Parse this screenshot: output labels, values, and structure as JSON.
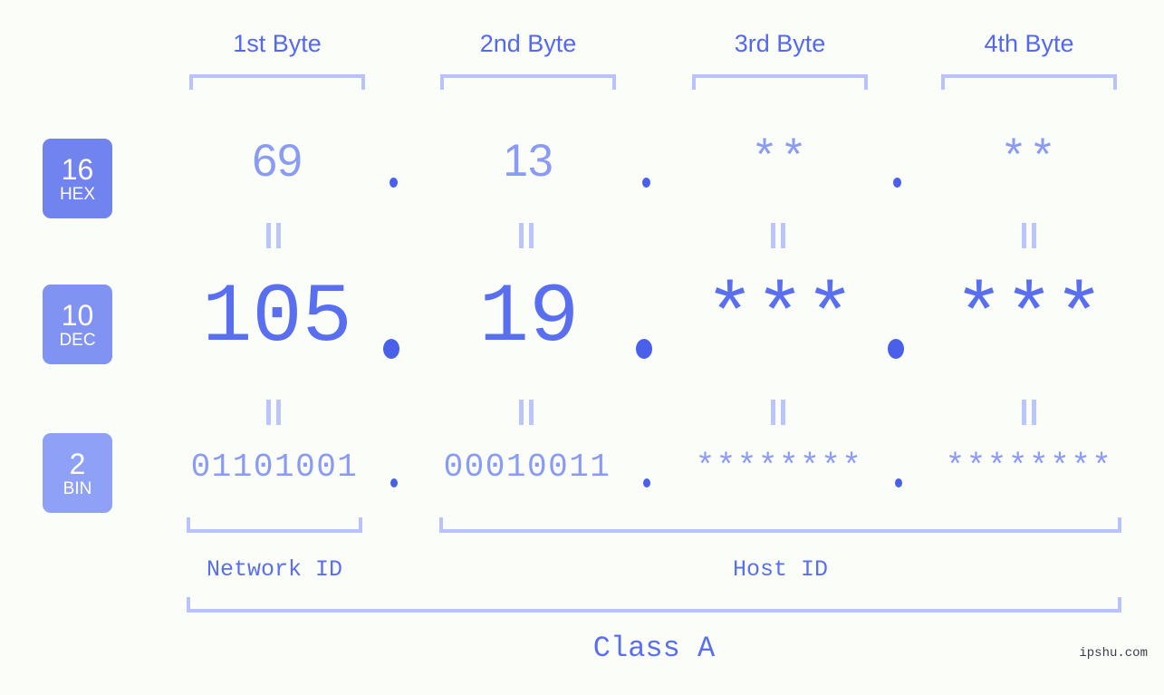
{
  "background_color": "#fbfdf9",
  "accent_color": "#5a6ef0",
  "muted_accent_color": "#8a9bf5",
  "bracket_color": "#b9c2fb",
  "byte_headers": [
    {
      "label": "1st Byte"
    },
    {
      "label": "2nd Byte"
    },
    {
      "label": "3rd Byte"
    },
    {
      "label": "4th Byte"
    }
  ],
  "bases": [
    {
      "number": "16",
      "name": "HEX",
      "color": "#7183ef"
    },
    {
      "number": "10",
      "name": "DEC",
      "color": "#8093f3"
    },
    {
      "number": "2",
      "name": "BIN",
      "color": "#8fa1f6"
    }
  ],
  "rows": {
    "hex": {
      "values": [
        "69",
        "13",
        "**",
        "**"
      ],
      "separator": "."
    },
    "dec": {
      "values": [
        "105",
        "19",
        "***",
        "***"
      ],
      "separator": "."
    },
    "bin": {
      "values": [
        "01101001",
        "00010011",
        "********",
        "********"
      ],
      "separator": "."
    }
  },
  "equality_symbol": "||",
  "sections": {
    "network_id": "Network ID",
    "host_id": "Host ID",
    "class": "Class A"
  },
  "watermark": "ipshu.com"
}
